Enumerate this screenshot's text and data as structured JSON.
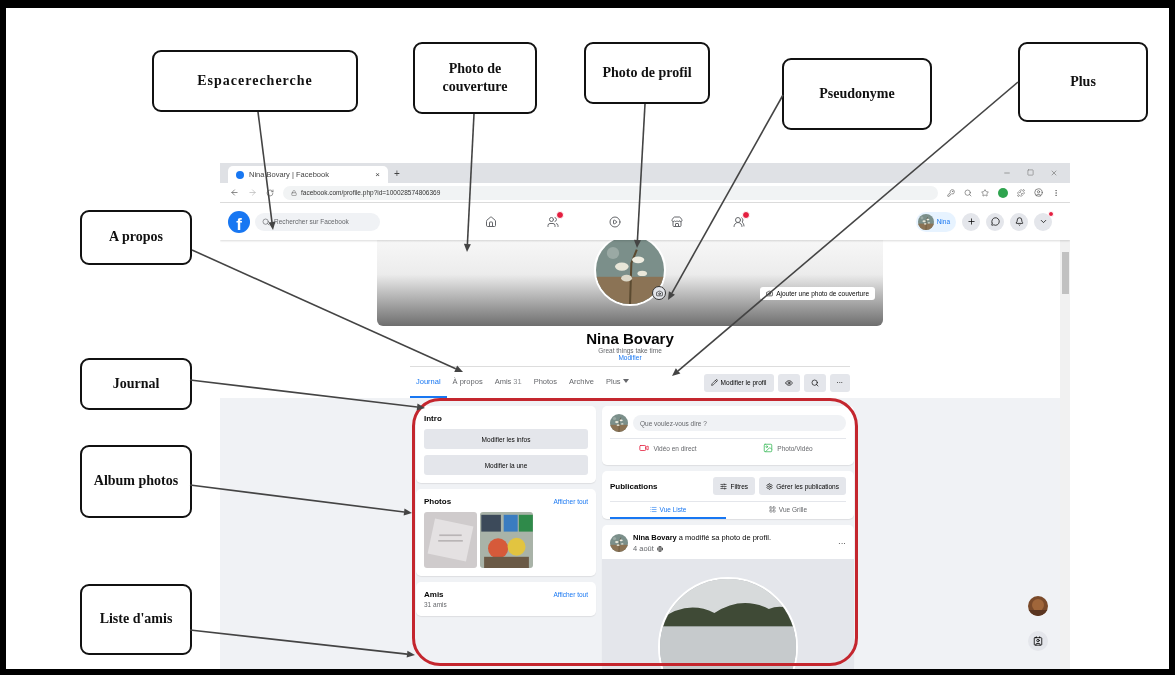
{
  "callouts": [
    {
      "label": "Espacerecherche"
    },
    {
      "label": "Photo de couverture"
    },
    {
      "label": "Photo de profil"
    },
    {
      "label": "Pseudonyme"
    },
    {
      "label": "Plus"
    },
    {
      "label": "A propos"
    },
    {
      "label": "Journal"
    },
    {
      "label": "Album photos"
    },
    {
      "label": "Liste d'amis"
    }
  ],
  "browser": {
    "tab_title": "Nina Bovary | Facebook",
    "tab_close": "×",
    "new_tab": "+",
    "url": "facebook.com/profile.php?id=100028574806369"
  },
  "navbar": {
    "logo": "f",
    "search": {
      "placeholder": "Rechercher sur Facebook"
    },
    "user_chip": "Nina"
  },
  "profile": {
    "cover_button": "Ajouter une photo de couverture",
    "name": "Nina Bovary",
    "bio": "Great things take time",
    "edit_link": "Modifier"
  },
  "tabs": [
    {
      "label": "Journal",
      "selected": true
    },
    {
      "label": "À propos",
      "selected": false
    },
    {
      "label": "Amis",
      "count": "31",
      "selected": false
    },
    {
      "label": "Photos",
      "selected": false
    },
    {
      "label": "Archive",
      "selected": false
    },
    {
      "label": "Plus",
      "selected": false,
      "dropdown": true
    }
  ],
  "profile_actions": {
    "edit": "Modifier le profil",
    "more": "···"
  },
  "intro": {
    "title": "Intro",
    "buttons": [
      "Modifier les infos",
      "Modifier la une"
    ]
  },
  "photos": {
    "title": "Photos",
    "link": "Afficher tout"
  },
  "friends": {
    "title": "Amis",
    "count": "31 amis",
    "link": "Afficher tout"
  },
  "composer": {
    "placeholder": "Que voulez-vous dire ?",
    "actions": [
      {
        "label": "Vidéo en direct",
        "kind": "video"
      },
      {
        "label": "Photo/Vidéo"
      }
    ]
  },
  "publications": {
    "title": "Publications",
    "buttons": [
      {
        "label": "Filtres",
        "kind": "filter"
      },
      {
        "label": "Gérer les publications",
        "kind": "manage"
      }
    ],
    "views": [
      {
        "label": "Vue Liste",
        "kind": "list",
        "selected": true
      },
      {
        "label": "Vue Grille",
        "kind": "grid",
        "selected": false
      }
    ]
  },
  "post": {
    "text": "**Nina Bovary** a modifié sa photo de profil.",
    "date": "4 août",
    "more": "···"
  }
}
